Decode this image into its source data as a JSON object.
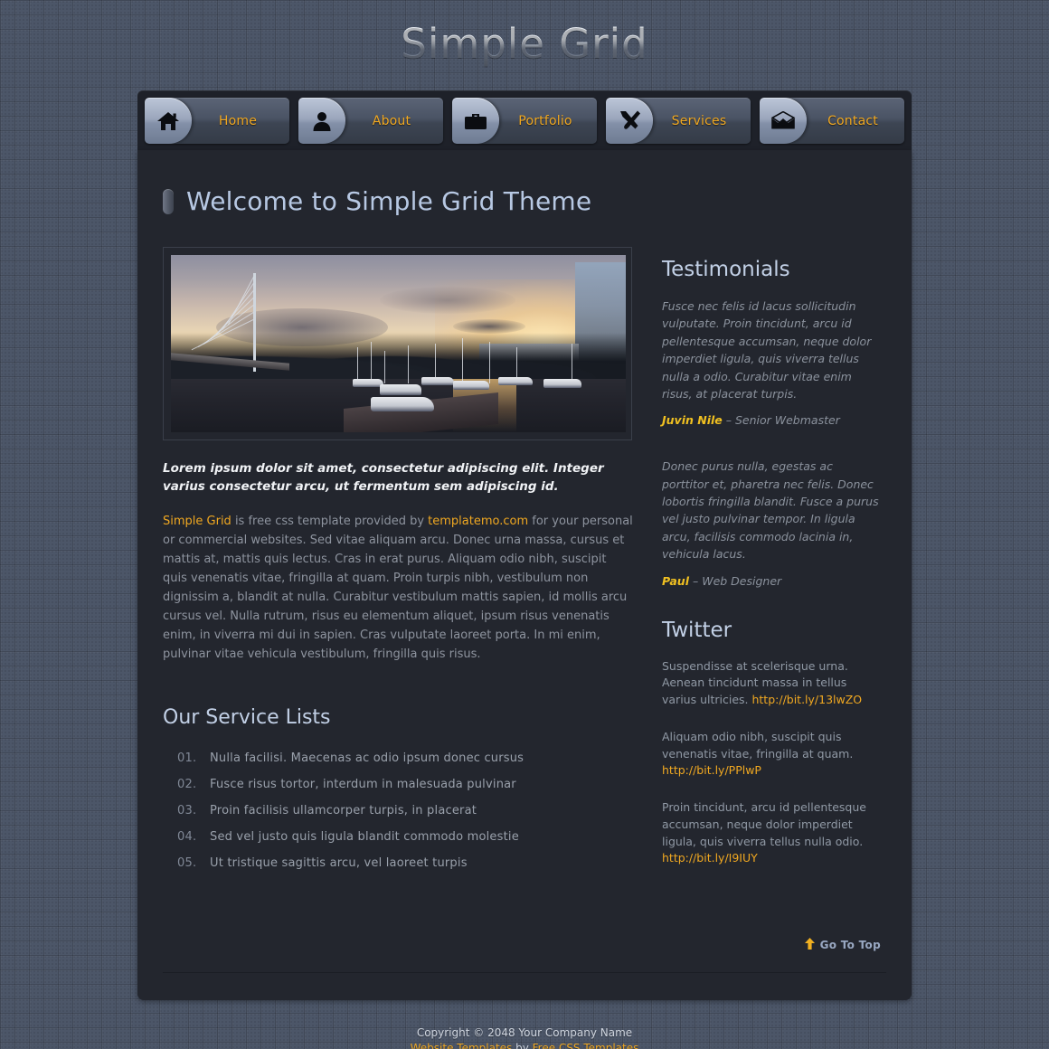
{
  "site": {
    "title": "Simple Grid"
  },
  "nav": {
    "items": [
      {
        "label": "Home",
        "icon": "home-icon"
      },
      {
        "label": "About",
        "icon": "person-icon"
      },
      {
        "label": "Portfolio",
        "icon": "briefcase-icon"
      },
      {
        "label": "Services",
        "icon": "tools-icon"
      },
      {
        "label": "Contact",
        "icon": "envelope-icon"
      }
    ]
  },
  "main": {
    "heading": "Welcome to Simple Grid Theme",
    "feature_image_alt": "Marina harbor at sunset with boats, dock and cable-stayed bridge",
    "lead_text": "Lorem ipsum dolor sit amet, consectetur adipiscing elit. Integer varius consectetur arcu, ut fermentum sem adipiscing id.",
    "paragraph": {
      "brand": "Simple Grid",
      "part1": " is free css template provided by ",
      "provider_link": "templatemo.com",
      "part2": " for your personal or commercial websites. Sed vitae aliquam arcu. Donec urna massa, cursus et mattis at, mattis quis lectus. Cras in erat purus. Aliquam odio nibh, suscipit quis venenatis vitae, fringilla at quam. Proin turpis nibh, vestibulum non dignissim a, blandit at nulla. Curabitur vestibulum mattis sapien, id mollis arcu cursus vel. Nulla rutrum, risus eu elementum aliquet, ipsum risus venenatis enim, in viverra mi dui in sapien. Cras vulputate laoreet porta. In mi enim, pulvinar vitae vehicula vestibulum, fringilla quis risus."
    },
    "services_heading": "Our Service Lists",
    "services": [
      {
        "num": "01.",
        "text": "Nulla facilisi. Maecenas ac odio ipsum donec cursus"
      },
      {
        "num": "02.",
        "text": "Fusce risus tortor, interdum in malesuada pulvinar"
      },
      {
        "num": "03.",
        "text": "Proin facilisis ullamcorper turpis, in placerat"
      },
      {
        "num": "04.",
        "text": "Sed vel justo quis ligula blandit commodo molestie"
      },
      {
        "num": "05.",
        "text": "Ut tristique sagittis arcu, vel laoreet turpis"
      }
    ],
    "go_to_top": "Go To Top"
  },
  "sidebar": {
    "testimonials_heading": "Testimonials",
    "testimonials": [
      {
        "quote": "Fusce nec felis id lacus sollicitudin vulputate. Proin tincidunt, arcu id pellentesque accumsan, neque dolor imperdiet ligula, quis viverra tellus nulla a odio. Curabitur vitae enim risus, at placerat turpis.",
        "name": "Juvin Nile",
        "dash": "–",
        "role": "Senior Webmaster"
      },
      {
        "quote": "Donec purus nulla, egestas ac porttitor et, pharetra nec felis. Donec lobortis fringilla blandit. Fusce a purus vel justo pulvinar tempor. In ligula arcu, facilisis commodo lacinia in, vehicula lacus.",
        "name": "Paul",
        "dash": "–",
        "role": "Web Designer"
      }
    ],
    "twitter_heading": "Twitter",
    "tweets": [
      {
        "text": "Suspendisse at scelerisque urna. Aenean tincidunt massa in tellus varius ultricies. ",
        "link": "http://bit.ly/13lwZO",
        "after": ""
      },
      {
        "text": "Aliquam odio nibh, suscipit quis venenatis vitae, fringilla at quam. ",
        "link": "http://bit.ly/PPlwP",
        "after": ""
      },
      {
        "text": "Proin tincidunt, arcu id pellentesque accumsan, neque dolor imperdiet ligula, quis viverra tellus nulla odio. ",
        "link": "http://bit.ly/I9IUY",
        "after": ""
      }
    ]
  },
  "footer": {
    "copyright": "Copyright © 2048 Your Company Name",
    "templates_link": "Website Templates",
    "by_text": " by ",
    "credit_link": "Free CSS Templates"
  },
  "colors": {
    "accent_gold": "#f0a821",
    "heading_blue": "#b7c8e3",
    "page_bg": "#4c5668",
    "content_bg": "#23262e",
    "nav_bg": "#1e2129"
  }
}
